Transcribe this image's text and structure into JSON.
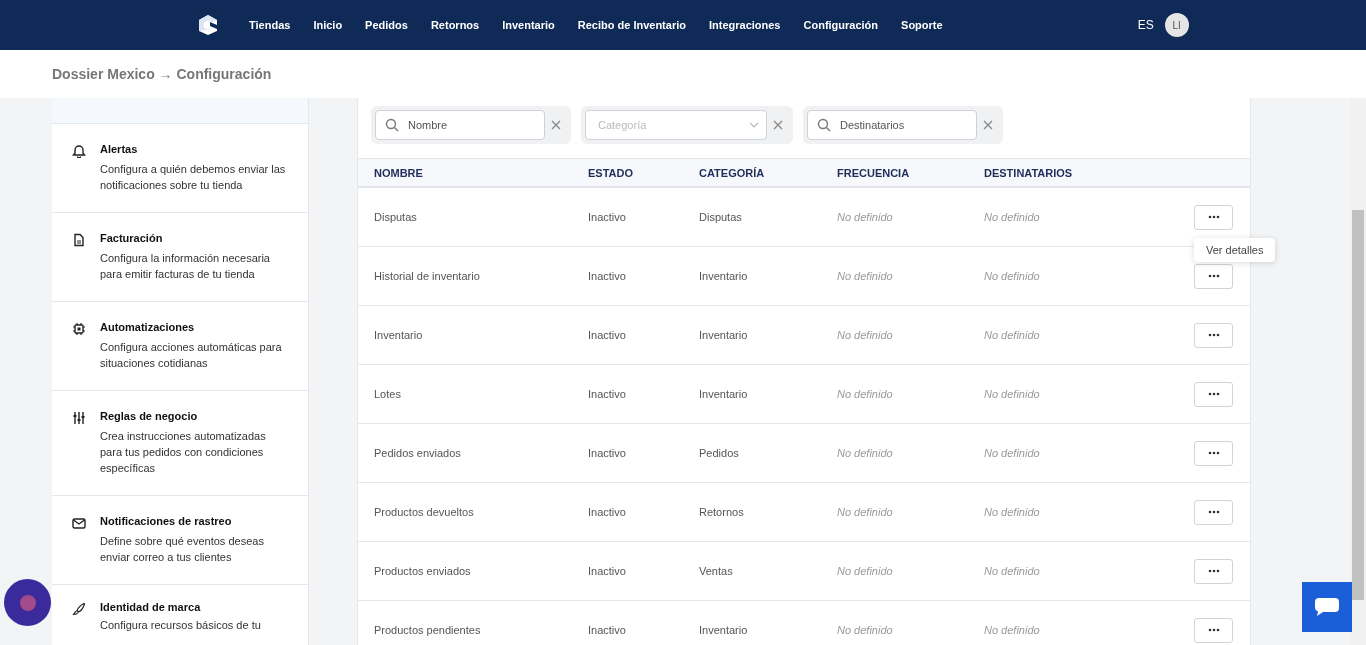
{
  "nav": {
    "items": [
      "Tiendas",
      "Inicio",
      "Pedidos",
      "Retornos",
      "Inventario",
      "Recibo de Inventario",
      "Integraciones",
      "Configuración",
      "Soporte"
    ],
    "language": "ES",
    "avatar": "LI"
  },
  "breadcrumb": {
    "parent": "Dossier Mexico",
    "separator": "→",
    "current": "Configuración"
  },
  "sidebar": {
    "items": [
      {
        "title": "Alertas",
        "description": "Configura a quién debemos enviar las notificaciones sobre tu tienda"
      },
      {
        "title": "Facturación",
        "description": "Configura la información necesaria para emitir facturas de tu tienda"
      },
      {
        "title": "Automatizaciones",
        "description": "Configura acciones automáticas para situaciones cotidianas"
      },
      {
        "title": "Reglas de negocio",
        "description": "Crea instrucciones automatizadas para tus pedidos con condiciones específicas"
      },
      {
        "title": "Notificaciones de rastreo",
        "description": "Define sobre qué eventos deseas enviar correo a tus clientes"
      },
      {
        "title": "Identidad de marca",
        "description": "Configura recursos básicos de tu"
      }
    ]
  },
  "filters": [
    {
      "kind": "search",
      "placeholder": "Nombre"
    },
    {
      "kind": "select",
      "placeholder": "Categoría"
    },
    {
      "kind": "search",
      "placeholder": "Destinatarios"
    }
  ],
  "table": {
    "columns": [
      "NOMBRE",
      "ESTADO",
      "CATEGORÍA",
      "FRECUENCIA",
      "DESTINATARIOS"
    ],
    "rows": [
      [
        "Disputas",
        "Inactivo",
        "Disputas",
        "No definido",
        "No definido"
      ],
      [
        "Historial de inventario",
        "Inactivo",
        "Inventario",
        "No definido",
        "No definido"
      ],
      [
        "Inventario",
        "Inactivo",
        "Inventario",
        "No definido",
        "No definido"
      ],
      [
        "Lotes",
        "Inactivo",
        "Inventario",
        "No definido",
        "No definido"
      ],
      [
        "Pedidos enviados",
        "Inactivo",
        "Pedidos",
        "No definido",
        "No definido"
      ],
      [
        "Productos devueltos",
        "Inactivo",
        "Retornos",
        "No definido",
        "No definido"
      ],
      [
        "Productos enviados",
        "Inactivo",
        "Ventas",
        "No definido",
        "No definido"
      ],
      [
        "Productos pendientes",
        "Inactivo",
        "Inventario",
        "No definido",
        "No definido"
      ]
    ]
  },
  "tooltip": {
    "text": "Ver detalles"
  }
}
